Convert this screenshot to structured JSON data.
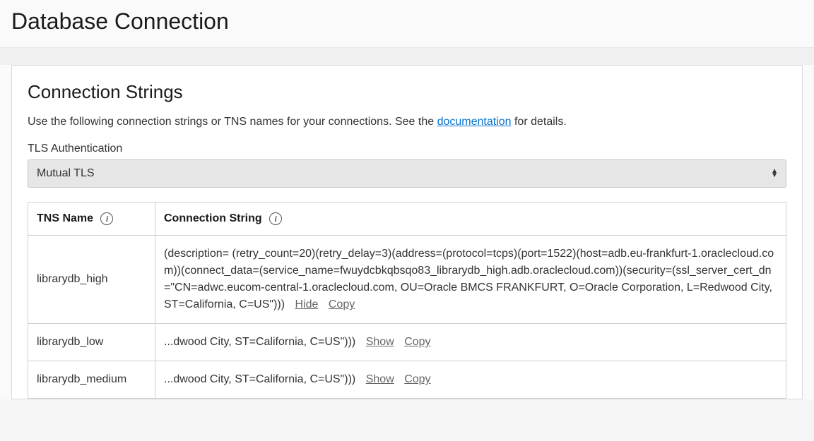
{
  "header": {
    "title": "Database Connection"
  },
  "section": {
    "title": "Connection Strings",
    "desc_pre": "Use the following connection strings or TNS names for your connections. See the ",
    "doc_link": "documentation",
    "desc_post": " for details."
  },
  "tls": {
    "label": "TLS Authentication",
    "selected": "Mutual TLS"
  },
  "table": {
    "col_tns": "TNS Name",
    "col_conn": "Connection String",
    "rows": [
      {
        "tns": "librarydb_high",
        "conn": "(description= (retry_count=20)(retry_delay=3)(address=(protocol=tcps)(port=1522)(host=adb.eu-frankfurt-1.oraclecloud.com))(connect_data=(service_name=fwuydcbkqbsqo83_librarydb_high.adb.oraclecloud.com))(security=(ssl_server_cert_dn=\"CN=adwc.eucom-central-1.oraclecloud.com, OU=Oracle BMCS FRANKFURT, O=Oracle Corporation, L=Redwood City, ST=California, C=US\")))",
        "toggle": "Hide",
        "copy": "Copy"
      },
      {
        "tns": "librarydb_low",
        "conn": "...dwood City, ST=California, C=US\")))",
        "toggle": "Show",
        "copy": "Copy"
      },
      {
        "tns": "librarydb_medium",
        "conn": "...dwood City, ST=California, C=US\")))",
        "toggle": "Show",
        "copy": "Copy"
      }
    ]
  }
}
